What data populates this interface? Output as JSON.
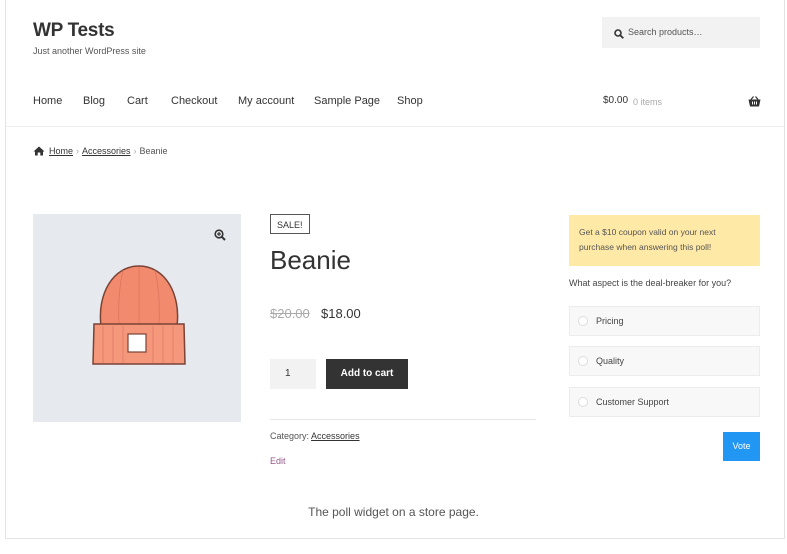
{
  "site": {
    "title": "WP Tests",
    "tagline": "Just another WordPress site"
  },
  "search": {
    "placeholder": "Search products…",
    "icon": "search-icon"
  },
  "nav": {
    "items": [
      "Home",
      "Blog",
      "Cart",
      "Checkout",
      "My account",
      "Sample Page",
      "Shop"
    ]
  },
  "cart": {
    "total": "$0.00",
    "items": "0 items",
    "icon": "basket-icon"
  },
  "breadcrumb": {
    "home": "Home",
    "category": "Accessories",
    "current": "Beanie",
    "separator": "›"
  },
  "product": {
    "sale_badge": "SALE!",
    "title": "Beanie",
    "old_price": "$20.00",
    "price": "$18.00",
    "quantity": "1",
    "add_to_cart": "Add to cart",
    "category_label": "Category:",
    "category": "Accessories",
    "edit": "Edit"
  },
  "poll": {
    "notice": "Get a $10 coupon valid on your next purchase when answering this poll!",
    "question": "What aspect is the deal-breaker for you?",
    "options": [
      "Pricing",
      "Quality",
      "Customer Support"
    ],
    "vote_label": "Vote"
  },
  "caption": "The poll widget on a store page.",
  "colors": {
    "accent": "#2196f3",
    "notice_bg": "#ffe9a6",
    "button_dark": "#333333",
    "beanie": "#f28b6e",
    "edit_link": "#96588a"
  }
}
